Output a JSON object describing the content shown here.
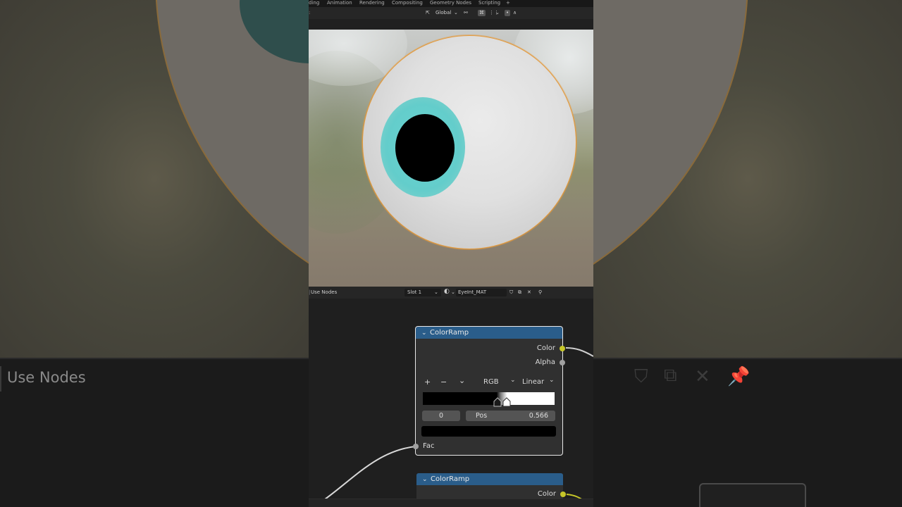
{
  "workspace_tabs": [
    "ding",
    "Animation",
    "Rendering",
    "Compositing",
    "Geometry Nodes",
    "Scripting",
    "+"
  ],
  "viewport_header": {
    "orientation": "Global"
  },
  "node_header": {
    "use_nodes": "Use Nodes",
    "slot": "Slot 1",
    "material_name": "EyeInt_MAT"
  },
  "background_echo": {
    "use_nodes": "Use Nodes"
  },
  "color_ramp_node": {
    "title": "ColorRamp",
    "outputs": [
      "Color",
      "Alpha"
    ],
    "add_label": "+",
    "remove_label": "−",
    "menu_label": "⌄",
    "color_mode": "RGB",
    "interpolation": "Linear",
    "stop_index": "0",
    "pos_label": "Pos",
    "pos_value": "0.566",
    "input_label": "Fac",
    "stop_color": "#000000"
  },
  "color_ramp_node_2": {
    "title": "ColorRamp",
    "outputs": [
      "Color"
    ]
  },
  "colors": {
    "node_header": "#2a5d8a",
    "color_socket": "#c7c729",
    "float_socket": "#a1a1a1",
    "selection_outline": "#e39a3d",
    "iris": "#63cdcb"
  }
}
